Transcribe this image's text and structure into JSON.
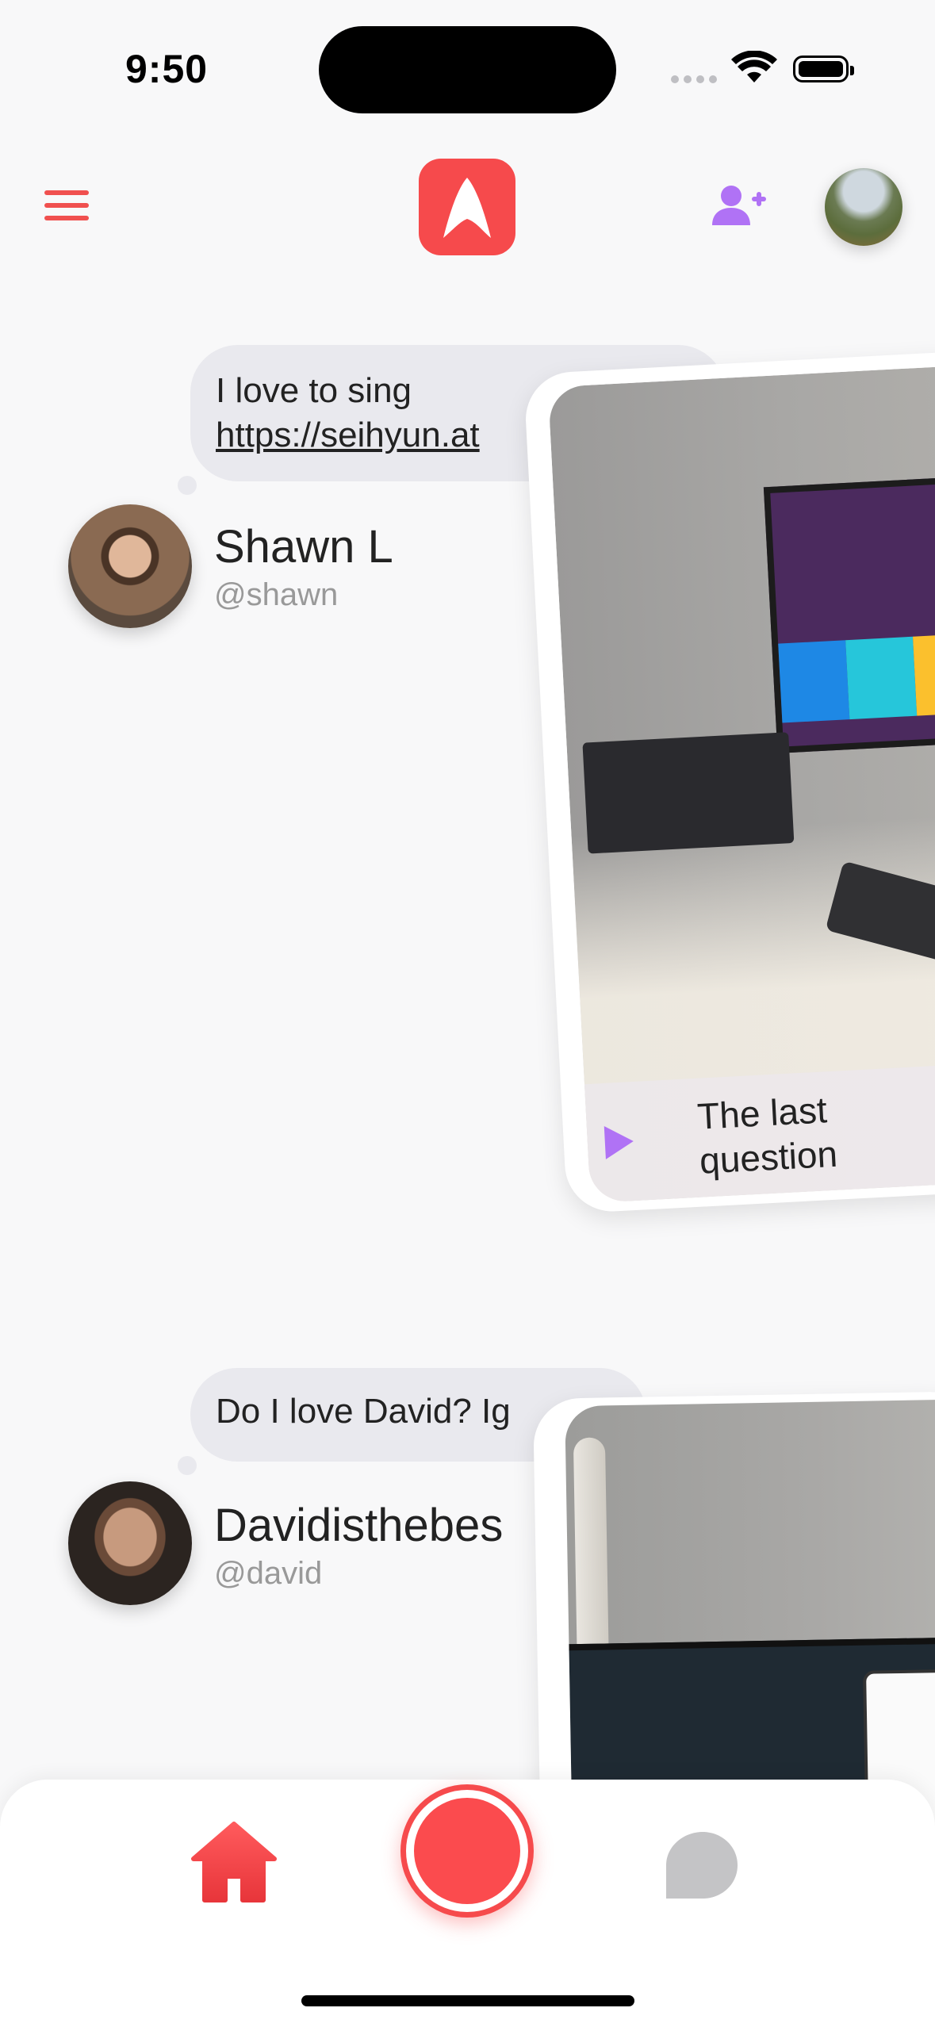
{
  "status_bar": {
    "time": "9:50"
  },
  "header": {
    "menu_icon": "menu-icon",
    "logo_icon": "app-logo",
    "add_friend_icon": "user-plus-icon",
    "avatar": "profile-avatar"
  },
  "colors": {
    "accent": "#f64a4c",
    "purple": "#b072f5",
    "bubble": "#e9e9ee"
  },
  "feed": [
    {
      "message_line1": "I love to sing",
      "message_line2": "https://seihyun.at",
      "name": "Shawn L",
      "handle": "@shawn",
      "card_caption": "The last question",
      "card_caption_line1": "The last",
      "card_caption_line2": "question"
    },
    {
      "message_line1": "Do I love David? Ig",
      "name": "Davidisthebes",
      "handle": "@david"
    }
  ],
  "tabbar": {
    "home_icon": "home-icon",
    "record_icon": "record-button",
    "chat_icon": "chat-bubble-icon"
  }
}
